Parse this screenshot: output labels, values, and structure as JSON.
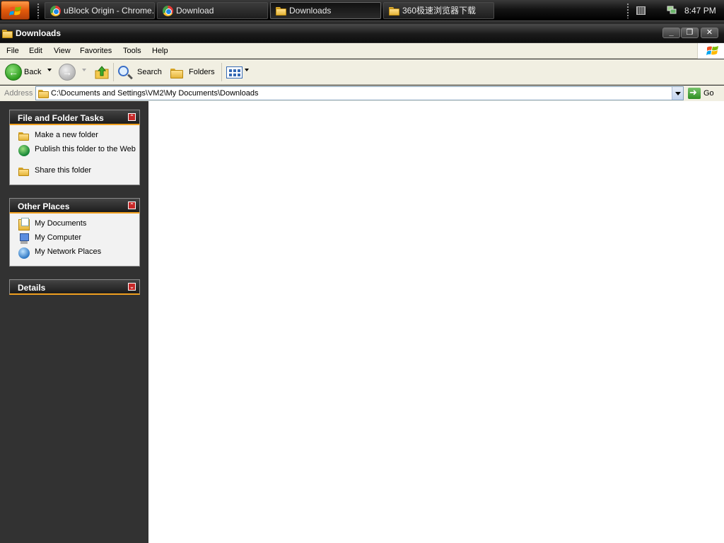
{
  "taskbar": {
    "tasks": [
      {
        "label": "uBlock Origin - Chrome...",
        "icon": "chrome-icon"
      },
      {
        "label": "Download",
        "icon": "chrome-icon"
      },
      {
        "label": "Downloads",
        "icon": "folder-icon",
        "active": true
      },
      {
        "label": "360极速浏览器下载",
        "icon": "folder-icon"
      }
    ],
    "clock": "8:47 PM"
  },
  "window": {
    "title": "Downloads",
    "controls": {
      "minimize": "_",
      "restore": "❐",
      "close": "✕"
    }
  },
  "menu": {
    "items": [
      "File",
      "Edit",
      "View",
      "Favorites",
      "Tools",
      "Help"
    ]
  },
  "toolbar": {
    "back_label": "Back",
    "search_label": "Search",
    "folders_label": "Folders"
  },
  "address": {
    "label": "Address",
    "path": "C:\\Documents and Settings\\VM2\\My Documents\\Downloads",
    "go_label": "Go"
  },
  "taskpane": {
    "file_tasks": {
      "title": "File and Folder Tasks",
      "items": [
        "Make a new folder",
        "Publish this folder to the Web",
        "Share this folder"
      ]
    },
    "other_places": {
      "title": "Other Places",
      "items": [
        "My Documents",
        "My Computer",
        "My Network Places"
      ]
    },
    "details": {
      "title": "Details"
    }
  },
  "colors": {
    "accent_orange": "#f0a020",
    "pane_bg": "#323232",
    "content_bg": "#ffffff"
  }
}
